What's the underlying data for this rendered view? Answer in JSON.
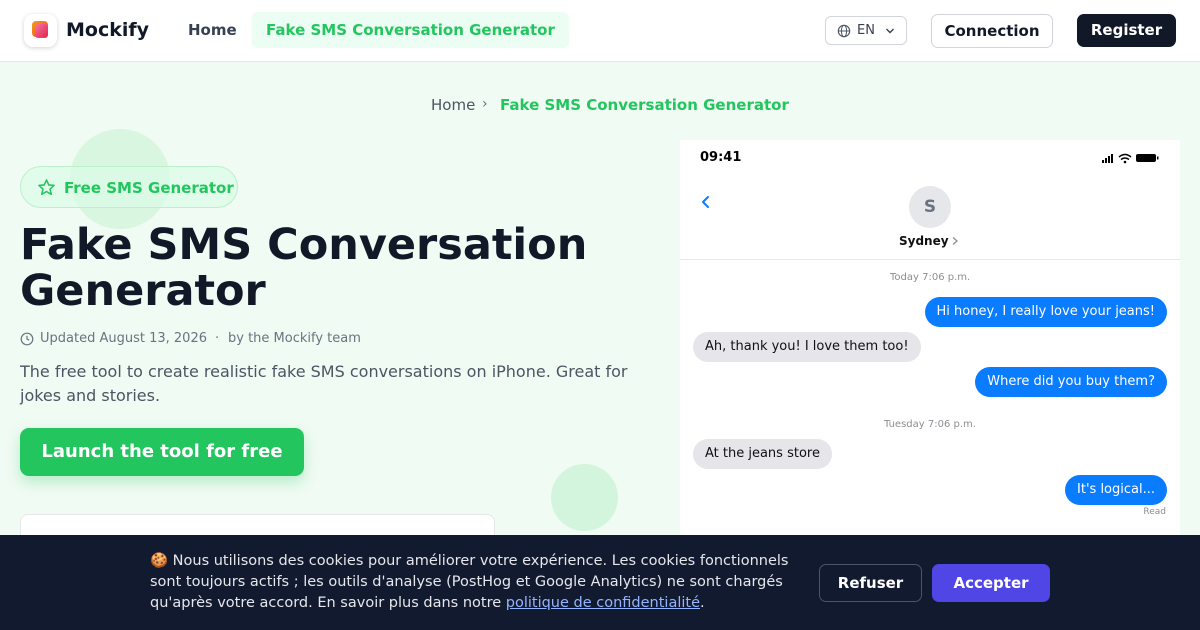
{
  "nav": {
    "brand": "Mockify",
    "home": "Home",
    "active": "Fake SMS Conversation Generator",
    "lang": "EN",
    "connection": "Connection",
    "register": "Register"
  },
  "breadcrumb": {
    "home": "Home",
    "separator": "›",
    "current": "Fake SMS Conversation Generator"
  },
  "hero": {
    "badge": "Free SMS Generator",
    "title": "Fake SMS Conversation Generator",
    "updated": "Updated August 13, 2026",
    "dot": "·",
    "author": "by the Mockify team",
    "description": "The free tool to create realistic fake SMS conversations on iPhone. Great for jokes and stories.",
    "cta": "Launch the tool for free"
  },
  "phone": {
    "time": "09:41",
    "contact_initial": "S",
    "contact_name": "Sydney",
    "timestamp1": "Today 7:06 p.m.",
    "timestamp2": "Tuesday 7:06 p.m.",
    "messages": [
      {
        "dir": "out",
        "text": "Hi honey, I really love your jeans!"
      },
      {
        "dir": "in",
        "text": "Ah, thank you! I love them too!"
      },
      {
        "dir": "out",
        "text": "Where did you buy them?"
      },
      {
        "dir": "in",
        "text": "At the jeans store"
      },
      {
        "dir": "out",
        "text": "It's logical..."
      }
    ],
    "read": "Read"
  },
  "cookie": {
    "text_before": "🍪 Nous utilisons des cookies pour améliorer votre expérience. Les cookies fonctionnels sont toujours actifs ; les outils d'analyse (PostHog et Google Analytics) ne sont chargés qu'après votre accord. En savoir plus dans notre ",
    "link": "politique de confidentialité",
    "text_after": ".",
    "refuse": "Refuser",
    "accept": "Accepter"
  },
  "colors": {
    "accent": "#22c55e",
    "bubble_out": "#0a7cff",
    "bubble_in": "#e5e5ea",
    "banner_bg": "#121a30",
    "accept_bg": "#4f46e5"
  },
  "icons": [
    "logo-icon",
    "globe-icon",
    "chevron-down-icon",
    "star-icon",
    "clock-icon",
    "back-chevron-icon",
    "signal-icon",
    "wifi-icon",
    "battery-icon"
  ]
}
